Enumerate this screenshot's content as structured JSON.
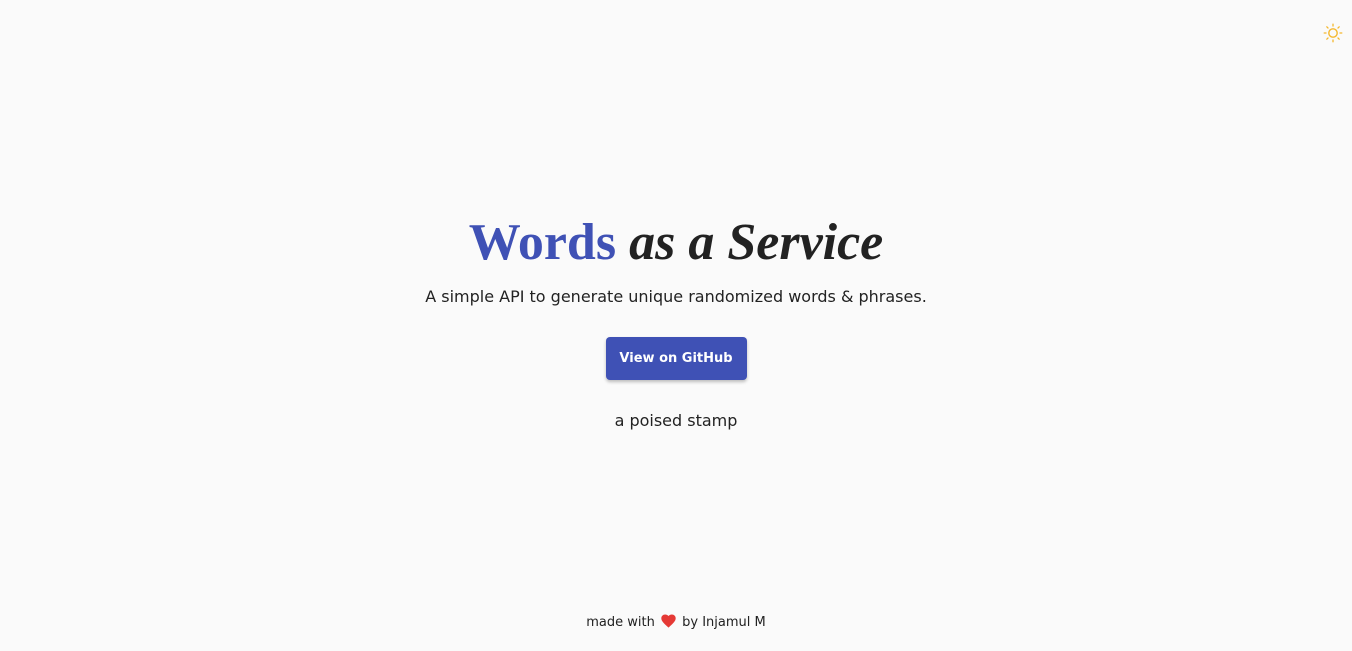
{
  "theme_toggle": {
    "icon": "sun-icon",
    "color": "#f5b82e"
  },
  "hero": {
    "title_accent": "Words",
    "title_rest": "as a Service",
    "accent_color": "#3f51b5",
    "subtitle": "A simple API to generate unique randomized words & phrases.",
    "button_label": "View on GitHub",
    "phrase": "a poised stamp"
  },
  "footer": {
    "prefix": "made with",
    "icon": "heart-icon",
    "heart_color": "#e53935",
    "suffix": "by Injamul M"
  }
}
